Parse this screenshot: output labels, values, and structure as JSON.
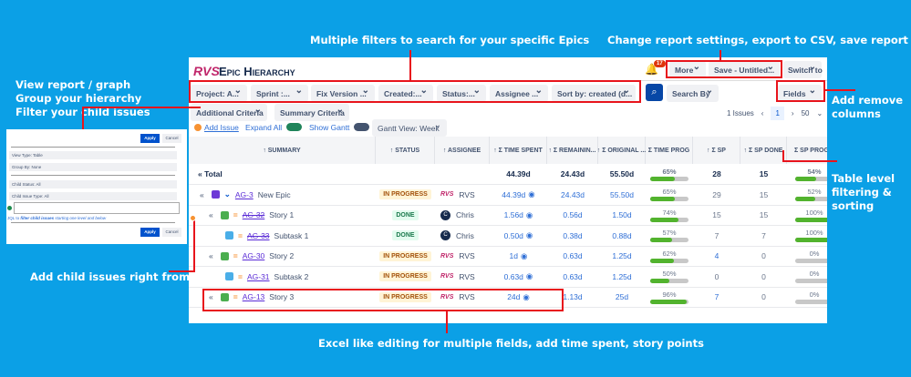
{
  "annotations": {
    "filters": "Multiple filters to search for your specific Epics",
    "settings": "Change report settings, export to CSV, save report",
    "left": [
      "View report / graph",
      "Group your hierarchy",
      "Filter your child issues"
    ],
    "columns": [
      "Add remove",
      "columns"
    ],
    "table_filter": [
      "Table level",
      "filtering &",
      "sorting"
    ],
    "child": "Add child issues right from here",
    "excel": "Excel like editing for multiple fields, add time spent, story points"
  },
  "app": {
    "logo": "RVS",
    "title": "Epic Hierarchy",
    "notifications": "17",
    "more": "More",
    "save": "Save - Untitled...",
    "switch": "Switch to",
    "filters": [
      "Project: A...",
      "Sprint :...",
      "Fix Version ...",
      "Created:...",
      "Status:...",
      "Assignee ...",
      "Sort by: created (d..."
    ],
    "search_by": "Search By",
    "fields": "Fields",
    "additional": "Additional Criteria",
    "summary_criteria": "Summary Criteria",
    "add_issue": "Add Issue",
    "expand_all": "Expand All",
    "show_gantt": "Show Gantt",
    "gantt_view": "Gantt View: Week",
    "issues_count": "1 Issues",
    "page": "1",
    "page_size": "50",
    "columns": [
      "↑ SUMMARY",
      "↑ STATUS",
      "↑ ASSIGNEE",
      "↑ Σ TIME SPENT",
      "↑ Σ REMAININ...",
      "↑ Σ ORIGINAL ...",
      "Σ TIME PROG",
      "↑ Σ SP",
      "↑ Σ SP DONE",
      "Σ SP PROG"
    ],
    "total": {
      "label": "« Total",
      "time_spent": "44.39d",
      "remaining": "24.43d",
      "original": "55.50d",
      "time_prog": 65,
      "sp": "28",
      "sp_done": "15",
      "sp_prog": 54
    },
    "rows": [
      {
        "indent": 1,
        "type": "epic",
        "key": "AG-3",
        "summary": "New Epic",
        "status": "IN PROGRESS",
        "assignee": "RVS",
        "time_spent": "44.39d",
        "remaining": "24.43d",
        "original": "55.50d",
        "time_prog": 65,
        "sp": "29",
        "sp_done": "15",
        "sp_prog": 52
      },
      {
        "indent": 2,
        "type": "story",
        "key": "AG-32",
        "summary": "Story 1",
        "status": "DONE",
        "assignee": "Chris",
        "time_spent": "1.56d",
        "remaining": "0.56d",
        "original": "1.50d",
        "time_prog": 74,
        "sp": "15",
        "sp_done": "15",
        "sp_prog": 100
      },
      {
        "indent": 3,
        "type": "subtask",
        "key": "AG-33",
        "summary": "Subtask 1",
        "status": "DONE",
        "assignee": "Chris",
        "time_spent": "0.50d",
        "remaining": "0.38d",
        "original": "0.88d",
        "time_prog": 57,
        "sp": "7",
        "sp_done": "7",
        "sp_prog": 100
      },
      {
        "indent": 2,
        "type": "story",
        "key": "AG-30",
        "summary": "Story 2",
        "status": "IN PROGRESS",
        "assignee": "RVS",
        "time_spent": "1d",
        "remaining": "0.63d",
        "original": "1.25d",
        "time_prog": 62,
        "sp": "4",
        "sp_done": "0",
        "sp_prog": 0
      },
      {
        "indent": 3,
        "type": "subtask",
        "key": "AG-31",
        "summary": "Subtask 2",
        "status": "IN PROGRESS",
        "assignee": "RVS",
        "time_spent": "0.63d",
        "remaining": "0.63d",
        "original": "1.25d",
        "time_prog": 50,
        "sp": "0",
        "sp_done": "0",
        "sp_prog": 0
      },
      {
        "indent": 2,
        "type": "story",
        "key": "AG-13",
        "summary": "Story 3",
        "status": "IN PROGRESS",
        "assignee": "RVS",
        "time_spent": "24d",
        "remaining": "1.13d",
        "original": "25d",
        "time_prog": 96,
        "sp": "7",
        "sp_done": "0",
        "sp_prog": 0
      }
    ]
  },
  "panel": {
    "apply": "Apply",
    "cancel": "Cancel",
    "view_type": "View Type: Table",
    "group_by": "Group By: None",
    "child_status": "Child Status: All",
    "child_type": "Child Issue Type: All",
    "jql_prefix": "JQL to",
    "jql_link": "filter child issues",
    "jql_suffix": "starting one level and below"
  },
  "colors": {
    "background": "#0ba0e6",
    "accent_red": "#e8141c",
    "progress": "#52b32e",
    "link": "#2f6fd6"
  }
}
